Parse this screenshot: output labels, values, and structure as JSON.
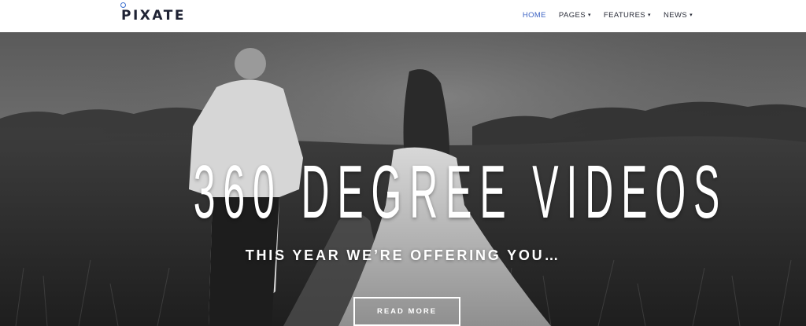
{
  "header": {
    "logo": "PIXATE",
    "nav": [
      {
        "label": "HOME",
        "active": true,
        "dropdown": false
      },
      {
        "label": "PAGES",
        "active": false,
        "dropdown": true
      },
      {
        "label": "FEATURES",
        "active": false,
        "dropdown": true
      },
      {
        "label": "NEWS",
        "active": false,
        "dropdown": true
      }
    ],
    "dropdown_icon": "caret-down-icon"
  },
  "hero": {
    "title": "360 DEGREE VIDEOS",
    "subtitle": "THIS YEAR WE’RE OFFERING YOU…",
    "button_label": "READ MORE",
    "image": "black-and-white photo of a couple holding hands walking along a grassy path"
  },
  "colors": {
    "accent": "#3e64c4",
    "nav_text": "#2b2e3a",
    "hero_text": "#ffffff"
  }
}
